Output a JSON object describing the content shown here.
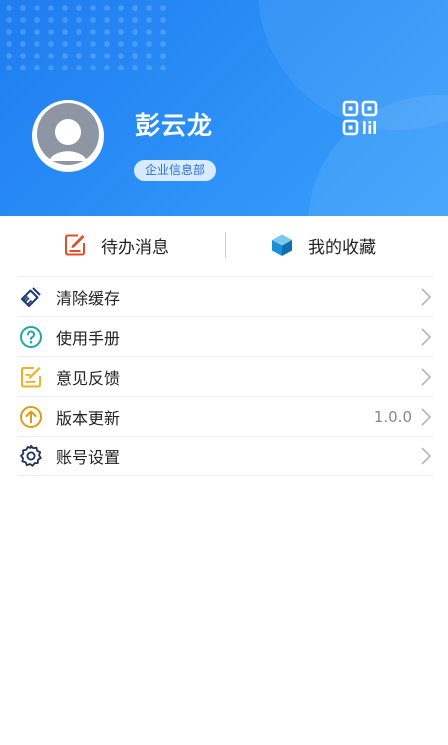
{
  "profile": {
    "name": "彭云龙",
    "department": "企业信息部"
  },
  "quick_actions": [
    {
      "label": "待办消息",
      "icon": "todo-edit-icon",
      "color": "#e2502b"
    },
    {
      "label": "我的收藏",
      "icon": "cube-box-icon",
      "color": "#1b8fd8"
    }
  ],
  "menu": {
    "items": [
      {
        "label": "清除缓存",
        "icon": "broom-icon",
        "color": "#1f3b73"
      },
      {
        "label": "使用手册",
        "icon": "question-circle-icon",
        "color": "#22a7a0"
      },
      {
        "label": "意见反馈",
        "icon": "feedback-edit-icon",
        "color": "#f0b020"
      },
      {
        "label": "版本更新",
        "icon": "upload-circle-icon",
        "color": "#e09a16",
        "value": "1.0.0"
      },
      {
        "label": "账号设置",
        "icon": "gear-icon",
        "color": "#1f2f5a"
      }
    ]
  },
  "colors": {
    "header_gradient_start": "#1e7df0",
    "header_gradient_end": "#3aa0fb",
    "badge_text": "#2c6fd1"
  },
  "header_icons": [
    "user-avatar-icon",
    "qr-code-icon"
  ]
}
